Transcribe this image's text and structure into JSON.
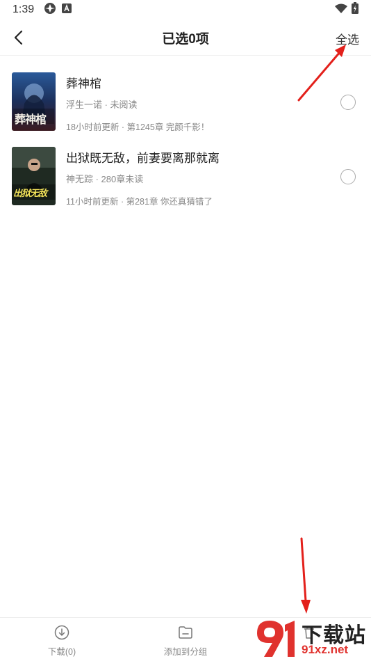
{
  "status_bar": {
    "time": "1:39"
  },
  "header": {
    "title": "已选0项",
    "select_all": "全选"
  },
  "books": [
    {
      "title": "葬神棺",
      "meta": "浮生一诺 · 未阅读",
      "update": "18小时前更新 · 第1245章 完颜千影！",
      "cover_text": "葬神棺",
      "checked": false
    },
    {
      "title": "出狱既无敌，前妻要离那就离",
      "meta": "神无踪 · 280章未读",
      "update": "11小时前更新 · 第281章 你还真猜错了",
      "cover_text": "出狱无敌",
      "checked": false
    }
  ],
  "bottom_bar": {
    "download": "下载(0)",
    "add_to_group": "添加到分组"
  },
  "watermark": {
    "chinese": "下载站",
    "domain": "91xz.net"
  },
  "colors": {
    "annotation_arrow": "#e3201b",
    "text_primary": "#222222",
    "text_secondary": "#888888"
  }
}
